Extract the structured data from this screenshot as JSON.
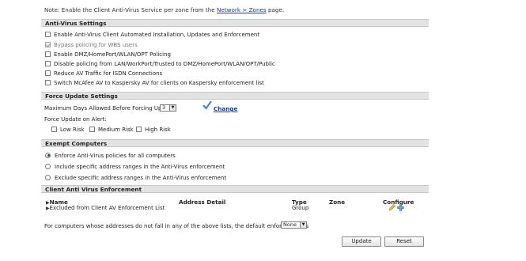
{
  "note": {
    "prefix": "Note: Enable the Client Anti-Virus Service per zone from the ",
    "link": "Network > Zones",
    "suffix": " page."
  },
  "antivirus_settings": {
    "title": "Anti-Virus Settings",
    "options": [
      {
        "label": "Enable Anti-Virus Client Automated Installation, Updates and Enforcement",
        "checked": false
      },
      {
        "label": "Bypass policing for WBS users",
        "checked": true
      },
      {
        "label": "Enable DMZ/HomePort/WLAN/OPT Policing",
        "checked": false
      },
      {
        "label": "Disable policing from LAN/WorkPort/Trusted to DMZ/HomePort/WLAN/OPT/Public",
        "checked": false
      },
      {
        "label": "Reduce AV Traffic for ISDN Connections",
        "checked": false
      },
      {
        "label": "Switch McAfee AV to Kaspersky AV for clients on Kaspersky enforcement list",
        "checked": false
      }
    ]
  },
  "force_update": {
    "title": "Force Update Settings",
    "max_days_label": "Maximum Days Allowed Before Forcing Update:",
    "max_days_value": "3",
    "change_label": "Change",
    "force_alert_label": "Force Update on Alert:",
    "alerts": [
      {
        "label": "Low Risk",
        "checked": false
      },
      {
        "label": "Medium Risk",
        "checked": false
      },
      {
        "label": "High Risk",
        "checked": false
      }
    ]
  },
  "exempt": {
    "title": "Exempt Computers",
    "options": [
      {
        "label": "Enforce Anti-Virus policies for all computers",
        "selected": true
      },
      {
        "label": "Include specific address ranges in the Anti-Virus enforcement",
        "selected": false
      },
      {
        "label": "Exclude specific address ranges in the Anti-Virus enforcement",
        "selected": false
      }
    ]
  },
  "enforcement": {
    "title": "Client Anti Virus Enforcement",
    "columns": {
      "name": "Name",
      "address": "Address Detail",
      "type": "Type",
      "zone": "Zone",
      "configure": "Configure"
    },
    "row": {
      "name": "Excluded from Client AV Enforcement List",
      "address": "",
      "type": "Group",
      "zone": ""
    },
    "default_label": "For computers whose addresses do not fall in any of the above lists, the default enforcement is",
    "default_value": "None"
  },
  "buttons": {
    "update": "Update",
    "reset": "Reset"
  },
  "colors": {
    "section_bg": "#e3e3e3",
    "link": "#1a3c8c",
    "check_blue": "#3a7bd5"
  }
}
